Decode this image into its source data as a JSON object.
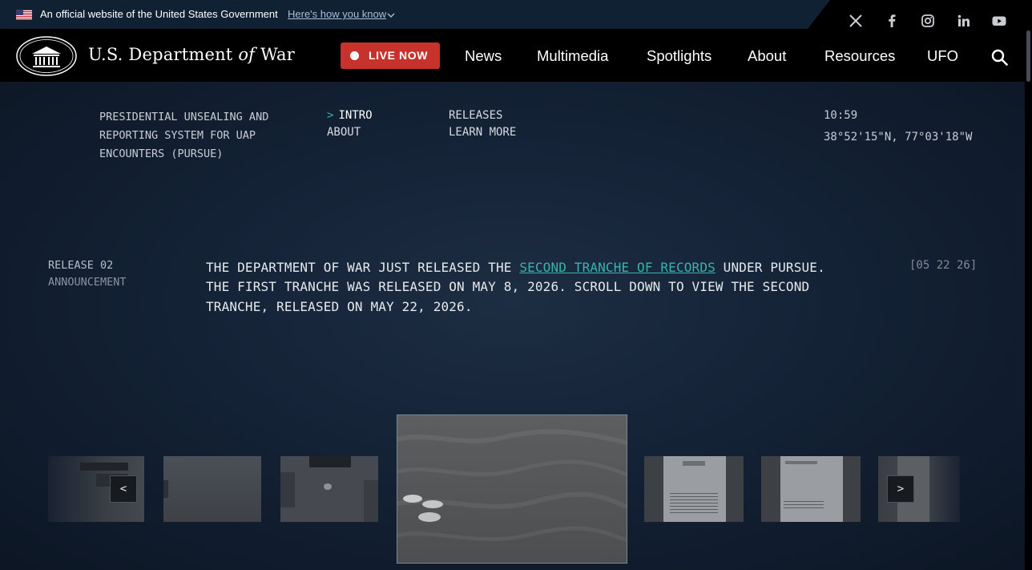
{
  "gov_banner": {
    "official_text": "An official website of the United States Government",
    "how_you_know": "Here's how you know"
  },
  "social": [
    "x-icon",
    "facebook-icon",
    "instagram-icon",
    "linkedin-icon",
    "youtube-icon"
  ],
  "header": {
    "site_name_pre": "U.S. Department",
    "site_name_of": "of",
    "site_name_post": "War",
    "live_label": "LIVE NOW",
    "nav": [
      "News",
      "Multimedia",
      "Spotlights",
      "About",
      "Resources",
      "UFO"
    ]
  },
  "hero": {
    "program_title": "PRESIDENTIAL UNSEALING AND REPORTING SYSTEM FOR UAP ENCOUNTERS (PURSUE)",
    "subnav": {
      "caret": ">",
      "intro": "INTRO",
      "about": "ABOUT",
      "releases": "RELEASES",
      "learn_more": "LEARN MORE"
    },
    "clock": "10:59",
    "coords": "38°52'15\"N, 77°03'18\"W",
    "release_tag": "RELEASE 02",
    "release_sub": "ANNOUNCEMENT",
    "announce_pre": "THE DEPARTMENT OF WAR JUST RELEASED THE ",
    "announce_link": "SECOND TRANCHE OF RECORDS",
    "announce_post": " UNDER PURSUE. THE FIRST TRANCHE WAS RELEASED ON MAY 8, 2026. SCROLL DOWN TO VIEW THE SECOND TRANCHE, RELEASED ON MAY 22, 2026.",
    "datestamp": "[05 22 26]"
  },
  "carousel": {
    "prev_label": "<",
    "next_label": ">"
  },
  "colors": {
    "accent_link": "#39b3ad",
    "live_red": "#c8322c",
    "header_bg": "#000000",
    "banner_bg": "#112134"
  }
}
